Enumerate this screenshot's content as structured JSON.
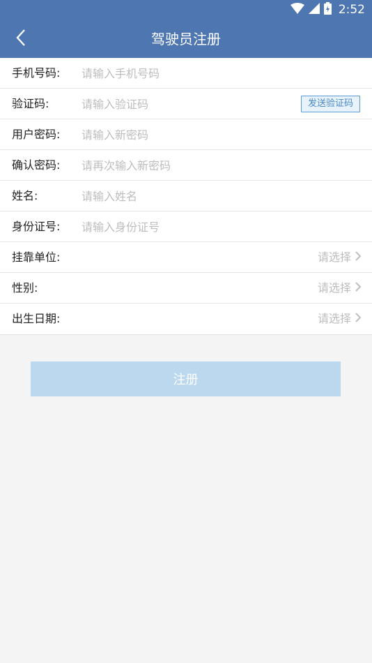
{
  "status_bar": {
    "time": "2:52"
  },
  "header": {
    "title": "驾驶员注册"
  },
  "form": {
    "phone": {
      "label": "手机号码:",
      "placeholder": "请输入手机号码"
    },
    "code": {
      "label": "验证码:",
      "placeholder": "请输入验证码",
      "button": "发送验证码"
    },
    "password": {
      "label": "用户密码:",
      "placeholder": "请输入新密码"
    },
    "confirm": {
      "label": "确认密码:",
      "placeholder": "请再次输入新密码"
    },
    "name": {
      "label": "姓名:",
      "placeholder": "请输入姓名"
    },
    "id_number": {
      "label": "身份证号:",
      "placeholder": "请输入身份证号"
    },
    "company": {
      "label": "挂靠单位:",
      "value": "请选择"
    },
    "gender": {
      "label": "性别:",
      "value": "请选择"
    },
    "birthday": {
      "label": "出生日期:",
      "value": "请选择"
    }
  },
  "register_button": "注册",
  "colors": {
    "header": "#4e76b0",
    "button": "#bcd8ef",
    "code_button_border": "#5b9bd5"
  }
}
